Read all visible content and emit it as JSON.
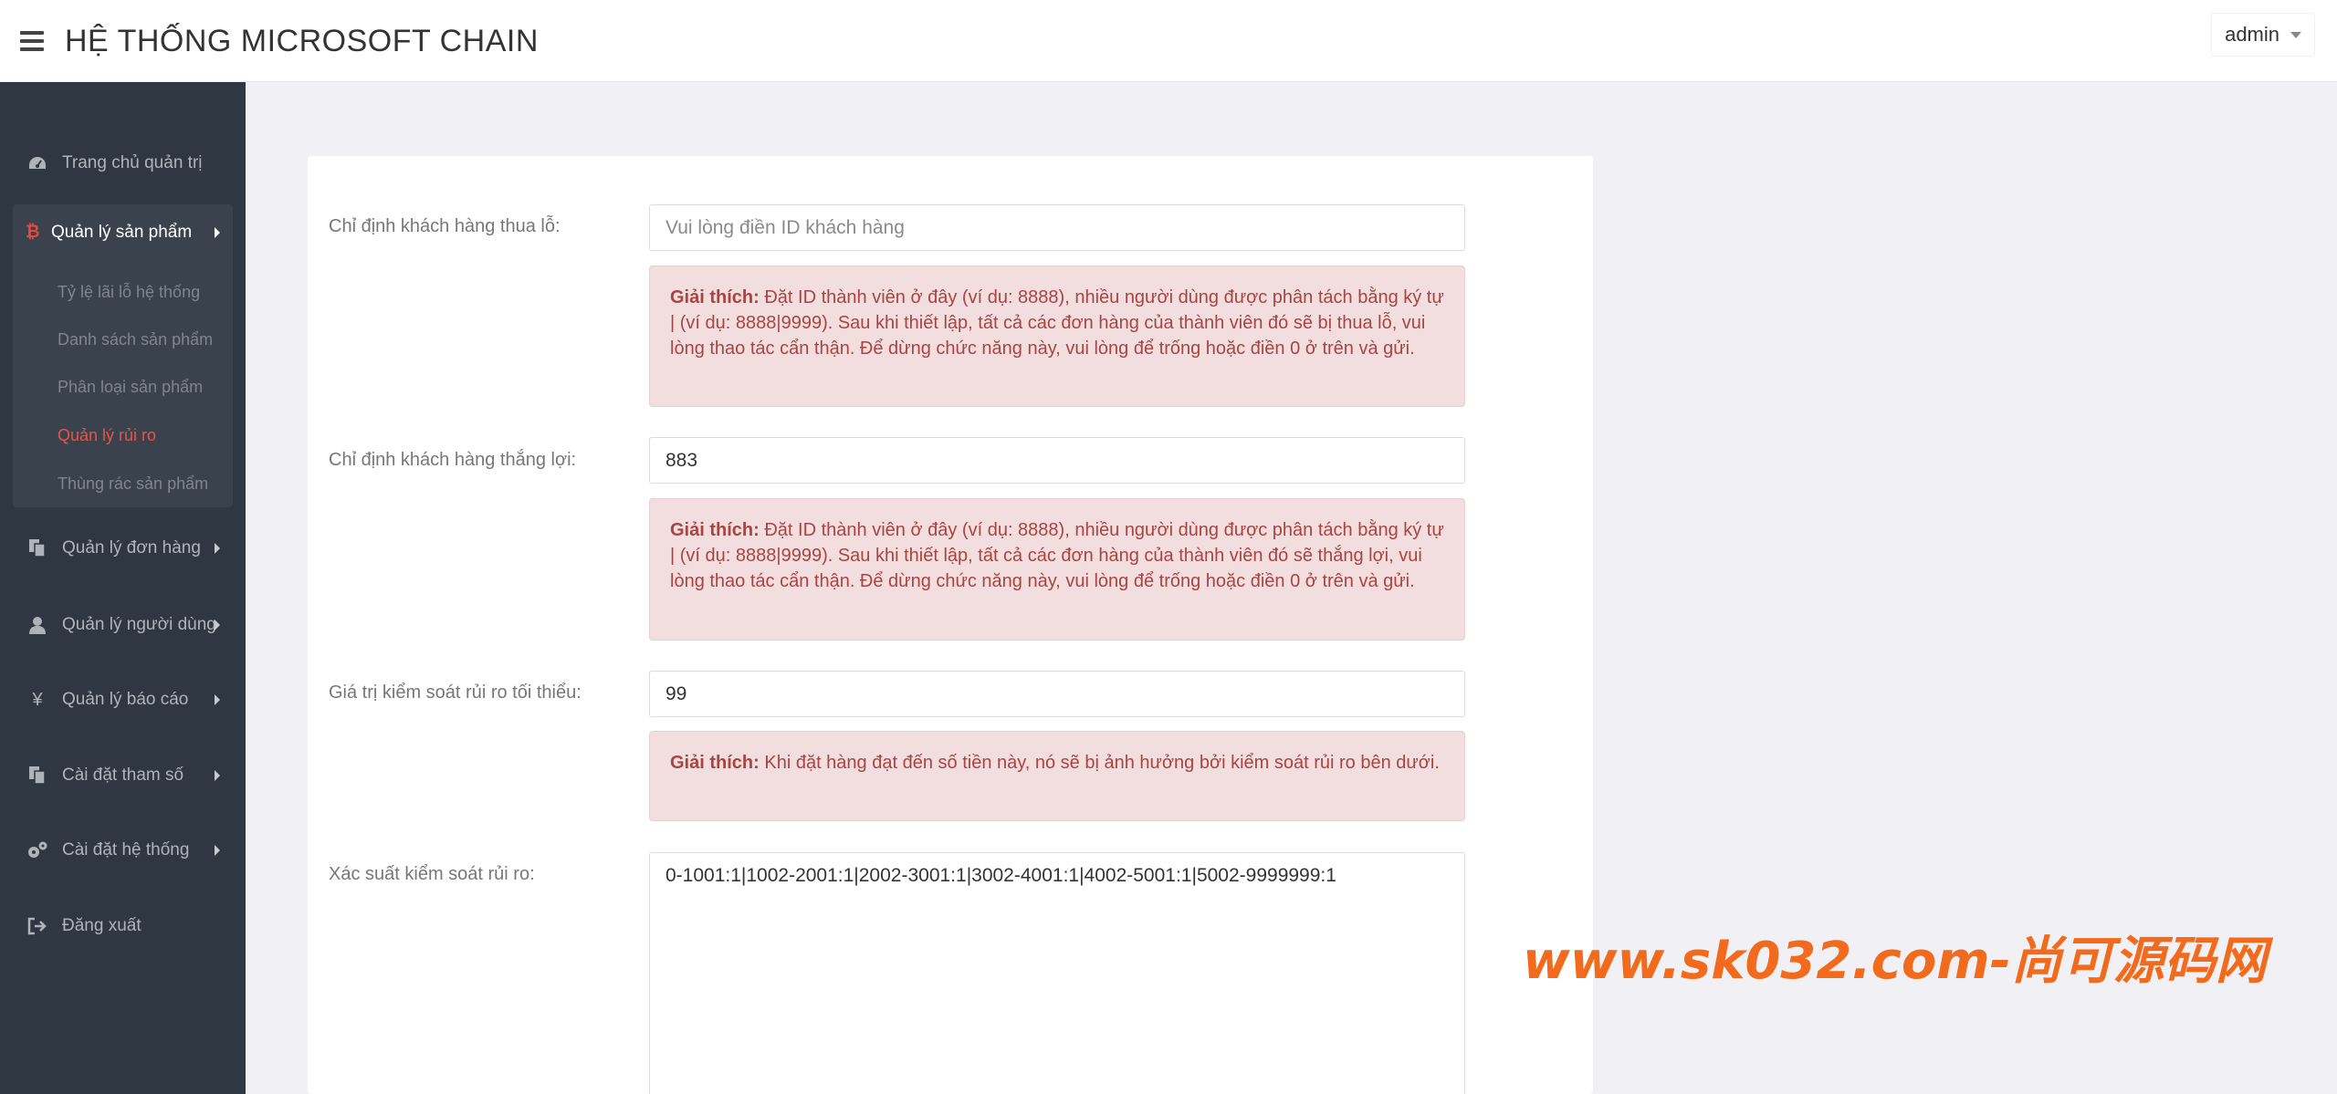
{
  "header": {
    "title": "HỆ THỐNG MICROSOFT CHAIN",
    "user": "admin"
  },
  "sidebar": {
    "items": [
      {
        "label": "Trang chủ quản trị",
        "icon": "dashboard-icon"
      },
      {
        "label": "Quản lý sản phẩm",
        "icon": "bitcoin-icon"
      },
      {
        "label": "Quản lý đơn hàng",
        "icon": "copy-icon"
      },
      {
        "label": "Quản lý người dùng",
        "icon": "user-icon"
      },
      {
        "label": "Quản lý báo cáo",
        "icon": "yen-icon"
      },
      {
        "label": "Cài đặt tham số",
        "icon": "copy-icon"
      },
      {
        "label": "Cài đặt hệ thống",
        "icon": "gears-icon"
      },
      {
        "label": "Đăng xuất",
        "icon": "sign-out-icon"
      }
    ],
    "product_sub": [
      {
        "label": "Tỷ lệ lãi lỗ hệ thống"
      },
      {
        "label": "Danh sách sản phẩm"
      },
      {
        "label": "Phân loại sản phẩm"
      },
      {
        "label": "Quản lý rủi ro",
        "active": true
      },
      {
        "label": "Thùng rác sản phẩm"
      }
    ]
  },
  "form": {
    "loser": {
      "label": "Chỉ định khách hàng thua lỗ:",
      "value": "",
      "placeholder": "Vui lòng điền ID khách hàng",
      "note_title": "Giải thích:",
      "note": "Đặt ID thành viên ở đây (ví dụ: 8888), nhiều người dùng được phân tách bằng ký tự | (ví dụ: 8888|9999). Sau khi thiết lập, tất cả các đơn hàng của thành viên đó sẽ bị thua lỗ, vui lòng thao tác cẩn thận. Để dừng chức năng này, vui lòng để trống hoặc điền 0 ở trên và gửi."
    },
    "winner": {
      "label": "Chỉ định khách hàng thắng lợi:",
      "value": "883",
      "note_title": "Giải thích:",
      "note": "Đặt ID thành viên ở đây (ví dụ: 8888), nhiều người dùng được phân tách bằng ký tự | (ví dụ: 8888|9999). Sau khi thiết lập, tất cả các đơn hàng của thành viên đó sẽ thắng lợi, vui lòng thao tác cẩn thận. Để dừng chức năng này, vui lòng để trống hoặc điền 0 ở trên và gửi."
    },
    "min_value": {
      "label": "Giá trị kiểm soát rủi ro tối thiểu:",
      "value": "99",
      "note_title": "Giải thích:",
      "note": "Khi đặt hàng đạt đến số tiền này, nó sẽ bị ảnh hưởng bởi kiểm soát rủi ro bên dưới."
    },
    "probability": {
      "label": "Xác suất kiểm soát rủi ro:",
      "value": "0-1001:1|1002-2001:1|2002-3001:1|3002-4001:1|4002-5001:1|5002-9999999:1"
    }
  },
  "watermark": "www.sk032.com-尚可源码网",
  "colors": {
    "sidebar_bg": "#2f3742",
    "active_item": "#e9534a",
    "alert_bg": "#f2dede",
    "alert_text": "#a94442"
  }
}
